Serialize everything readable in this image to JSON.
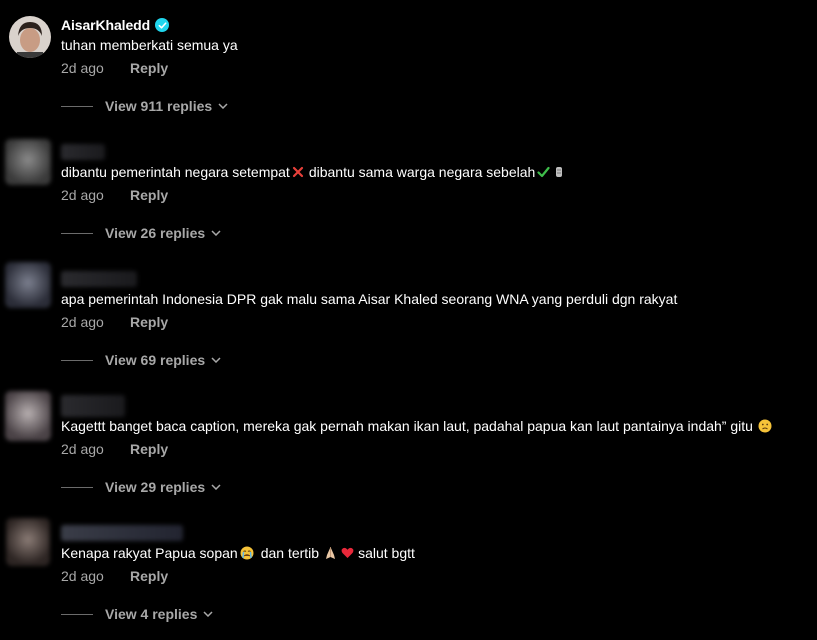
{
  "comments": [
    {
      "username": "AisarKhaledd",
      "verified": true,
      "text": "tuhan memberkati semua ya",
      "date": "2d ago",
      "reply": "Reply",
      "replies": "View 911 replies"
    },
    {
      "text_a": "dibantu pemerintah negara setempat",
      "text_b": "dibantu sama warga negara sebelah",
      "date": "2d ago",
      "reply": "Reply",
      "replies": "View 26 replies"
    },
    {
      "text": "apa pemerintah Indonesia DPR gak malu sama Aisar Khaled seorang WNA yang perduli dgn rakyat",
      "date": "2d ago",
      "reply": "Reply",
      "replies": "View 69 replies"
    },
    {
      "text": "Kagettt banget baca caption, mereka gak pernah makan ikan laut, padahal papua kan laut pantainya indah” gitu",
      "date": "2d ago",
      "reply": "Reply",
      "replies": "View 29 replies"
    },
    {
      "text_a": "Kenapa rakyat Papua sopan",
      "text_b": "dan tertib",
      "text_c": "salut bgtt",
      "date": "2d ago",
      "reply": "Reply",
      "replies": "View 4 replies"
    }
  ],
  "colors": {
    "background": "#000000",
    "secondary_text": "#a8a8a8",
    "verified": "#20d5ec"
  }
}
